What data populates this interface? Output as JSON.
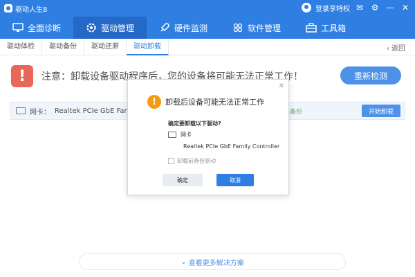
{
  "titlebar": {
    "app_title": "驱动人生8",
    "login_text": "登录享特权"
  },
  "nav": {
    "tabs": [
      {
        "label": "全面诊断",
        "icon": "monitor-icon"
      },
      {
        "label": "驱动管理",
        "icon": "gear-icon"
      },
      {
        "label": "硬件监测",
        "icon": "rocket-icon"
      },
      {
        "label": "软件管理",
        "icon": "apps-icon"
      },
      {
        "label": "工具箱",
        "icon": "toolbox-icon"
      }
    ],
    "active_tab": "驱动管理"
  },
  "subnav": {
    "tabs": [
      "驱动体检",
      "驱动备份",
      "驱动还原",
      "驱动卸载"
    ],
    "active_tab": "驱动卸载",
    "back_label": "返回"
  },
  "warning": {
    "text": "注意：卸载设备驱动程序后，您的设备将可能无法正常工作！",
    "recheck_label": "重新检测"
  },
  "driver_row": {
    "category": "网卡：",
    "name": "Realtek PCIe GbE Family",
    "backup_status": "已备份",
    "uninstall_label": "开始卸载"
  },
  "more_button": {
    "label": "查看更多解决方案"
  },
  "dialog": {
    "title": "卸载后设备可能无法正常工作",
    "question": "确定要卸载以下驱动?",
    "item_category": "网卡",
    "item_name": "Realtek PCIe GbE Family Controller",
    "checkbox_label": "卸载前备份驱动",
    "ok_label": "确定",
    "cancel_label": "取消"
  },
  "colors": {
    "primary": "#2f7fe3",
    "warning_red": "#e74c3c",
    "warning_orange": "#f39c12",
    "success_green": "#49a84f"
  }
}
